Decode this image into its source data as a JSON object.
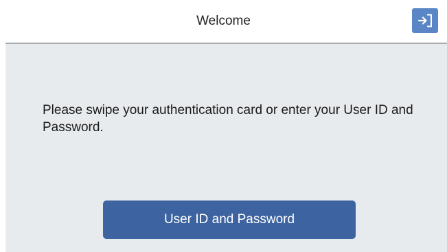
{
  "header": {
    "title": "Welcome",
    "login_icon": "login-arrow-icon"
  },
  "main": {
    "message": "Please swipe your authentication card or enter your User ID and Password.",
    "primary_button_label": "User ID and Password"
  },
  "colors": {
    "accent": "#3d64a0",
    "header_button": "#5b86c6",
    "panel_background": "#e8ebee"
  }
}
